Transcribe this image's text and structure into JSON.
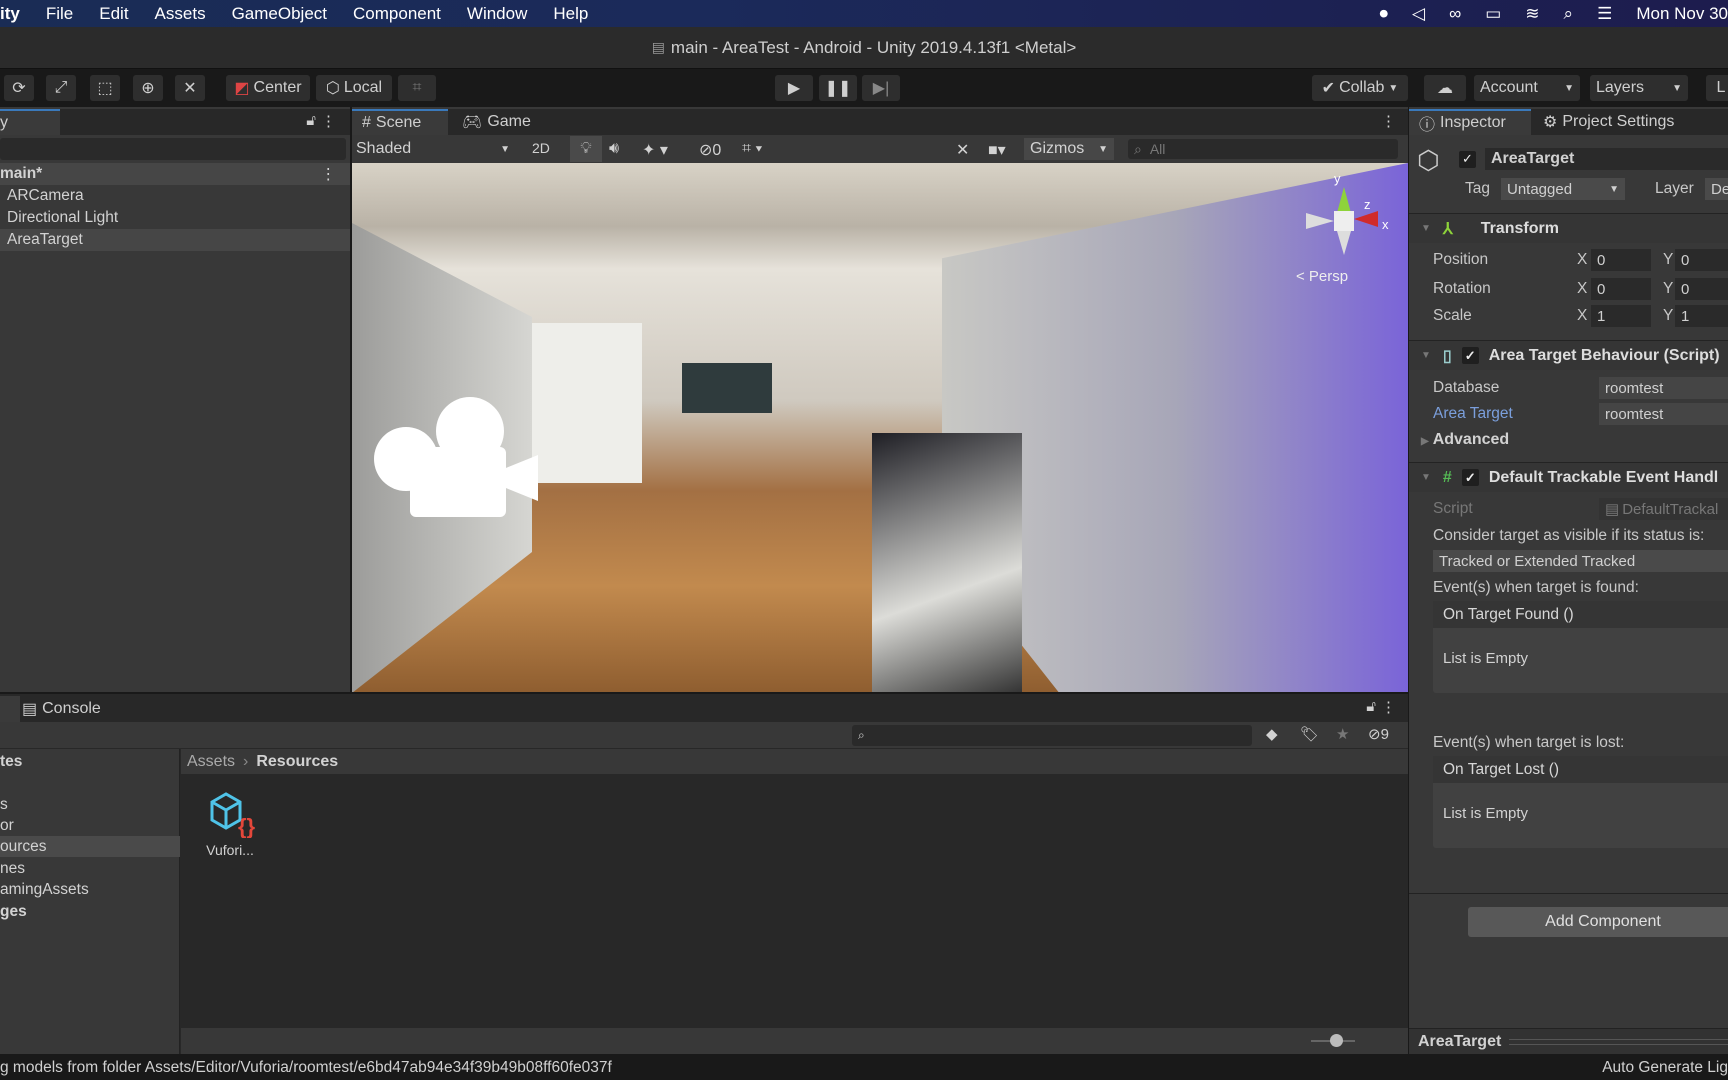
{
  "menubar": {
    "app": "ity",
    "items": [
      "File",
      "Edit",
      "Assets",
      "GameObject",
      "Component",
      "Window",
      "Help"
    ],
    "clock": "Mon Nov 30",
    "status_icons": [
      "record-icon",
      "unity-icon",
      "creative-cloud-icon",
      "battery-icon",
      "wifi-icon",
      "search-icon",
      "control-center-icon"
    ]
  },
  "titlebar": {
    "title": "main - AreaTest - Android - Unity 2019.4.13f1 <Metal>"
  },
  "toolbar": {
    "pivot": "Center",
    "space": "Local",
    "collab": "Collab",
    "account": "Account",
    "layers": "Layers",
    "layout": "L"
  },
  "hierarchy": {
    "tab": "y",
    "scene": "main*",
    "items": [
      "ARCamera",
      "Directional Light",
      "AreaTarget"
    ],
    "selected": 2
  },
  "scene": {
    "tab_scene": "Scene",
    "tab_game": "Game",
    "shading": "Shaded",
    "mode2d": "2D",
    "hidden_count": "0",
    "gizmos": "Gizmos",
    "search_placeholder": "All",
    "persp": "< Persp",
    "axis_y": "y",
    "axis_z": "z",
    "axis_x": "x"
  },
  "bottom": {
    "console_tab": "Console",
    "hidden_count": "9",
    "sidebar": [
      "tes",
      "",
      "s",
      "or",
      "ources",
      "nes",
      "amingAssets",
      "ges"
    ],
    "selected": 4,
    "breadcrumb": [
      "Assets",
      "Resources"
    ],
    "asset_name": "Vufori..."
  },
  "inspector": {
    "tab_inspector": "Inspector",
    "tab_settings": "Project Settings",
    "object_name": "AreaTarget",
    "tag_label": "Tag",
    "tag_value": "Untagged",
    "layer_label": "Layer",
    "layer_value": "De",
    "transform": {
      "title": "Transform",
      "rows": [
        {
          "label": "Position",
          "x": "0",
          "y": "0"
        },
        {
          "label": "Rotation",
          "x": "0",
          "y": "0"
        },
        {
          "label": "Scale",
          "x": "1",
          "y": "1"
        }
      ]
    },
    "behaviour": {
      "title": "Area Target Behaviour (Script)",
      "database_label": "Database",
      "database_value": "roomtest",
      "target_label": "Area Target",
      "target_value": "roomtest",
      "advanced": "Advanced"
    },
    "handler": {
      "title": "Default Trackable Event Handl",
      "script_label": "Script",
      "script_value": "DefaultTrackal",
      "consider": "Consider target as visible if its status is:",
      "status_value": "Tracked or Extended Tracked",
      "found_label": "Event(s) when target is found:",
      "found_event": "On Target Found ()",
      "found_empty": "List is Empty",
      "lost_label": "Event(s) when target is lost:",
      "lost_event": "On Target Lost ()",
      "lost_empty": "List is Empty"
    },
    "add_component": "Add Component",
    "preview_label": "AreaTarget"
  },
  "statusbar": {
    "message": "g models from folder Assets/Editor/Vuforia/roomtest/e6bd47ab94e34f39b49b08ff60fe037f",
    "right": "Auto Generate Lig"
  },
  "colors": {
    "accent": "#3a79bb",
    "link": "#7b9fdc"
  }
}
